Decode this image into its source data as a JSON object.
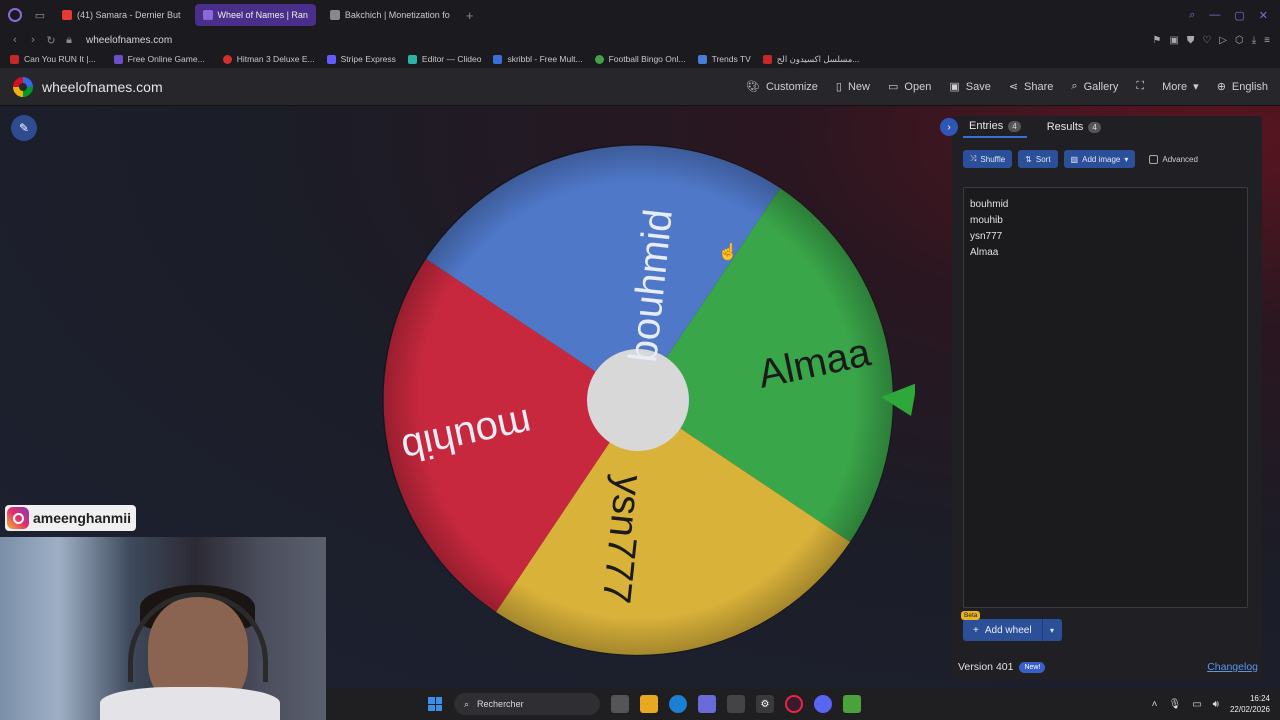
{
  "browser": {
    "tabs": [
      {
        "label": "(41) Samara - Dernier But",
        "active": false,
        "color": "#e53935"
      },
      {
        "label": "Wheel of Names | Ran",
        "active": true,
        "color": "#8b6ad8"
      },
      {
        "label": "Bakchich | Monetization fo",
        "active": false,
        "color": "#888888"
      }
    ],
    "url": "wheelofnames.com",
    "bookmarks": [
      {
        "label": "Can You RUN It |...",
        "color": "#c62828"
      },
      {
        "label": "Free Online Game...",
        "color": "#6a4fc9"
      },
      {
        "label": "Hitman 3 Deluxe E...",
        "color": "#d32f2f"
      },
      {
        "label": "Stripe Express",
        "color": "#635bff"
      },
      {
        "label": "Editor — Clideo",
        "color": "#2ab3a6"
      },
      {
        "label": "skribbl - Free Mult...",
        "color": "#3a6fd8"
      },
      {
        "label": "Football Bingo Onl...",
        "color": "#43a047"
      },
      {
        "label": "Trends TV",
        "color": "#4a7bd8"
      },
      {
        "label": "مسلسل اكسيدون الح...",
        "color": "#c62828"
      }
    ]
  },
  "site": {
    "name": "wheelofnames.com",
    "menu": [
      {
        "label": "Customize",
        "icon": "palette-icon"
      },
      {
        "label": "New",
        "icon": "file-icon"
      },
      {
        "label": "Open",
        "icon": "folder-icon"
      },
      {
        "label": "Save",
        "icon": "save-icon"
      },
      {
        "label": "Share",
        "icon": "share-icon"
      },
      {
        "label": "Gallery",
        "icon": "search-icon"
      },
      {
        "label": "",
        "icon": "fullscreen-icon"
      },
      {
        "label": "More",
        "icon": "chevron-down-icon"
      },
      {
        "label": "English",
        "icon": "globe-icon"
      }
    ]
  },
  "wheel": {
    "colors": {
      "blue": "#3369e8",
      "green": "#009925",
      "yellow": "#eeb211",
      "red": "#d50f25"
    },
    "segments": [
      {
        "label": "bouhmid",
        "color": "#4f78c9"
      },
      {
        "label": "Almaa",
        "color": "#3aa64a"
      },
      {
        "label": "ysn777",
        "color": "#d9b23a"
      },
      {
        "label": "mouhib",
        "color": "#c8283e"
      }
    ]
  },
  "panel": {
    "tabs": [
      {
        "label": "Entries",
        "count": "4"
      },
      {
        "label": "Results",
        "count": "4"
      }
    ],
    "tools": {
      "shuffle": "Shuffle",
      "sort": "Sort",
      "add_image": "Add image",
      "advanced": "Advanced"
    },
    "entries": [
      "bouhmid",
      "mouhib",
      "ysn777",
      "Almaa"
    ],
    "beta": "Beta",
    "add_wheel": "Add wheel",
    "version": "Version 401",
    "new_badge": "New!",
    "changelog": "Changelog"
  },
  "overlay": {
    "instagram_handle": "ameenghanmii"
  },
  "taskbar": {
    "search_placeholder": "Rechercher",
    "time": "16:24",
    "date": "22/02/2026"
  }
}
